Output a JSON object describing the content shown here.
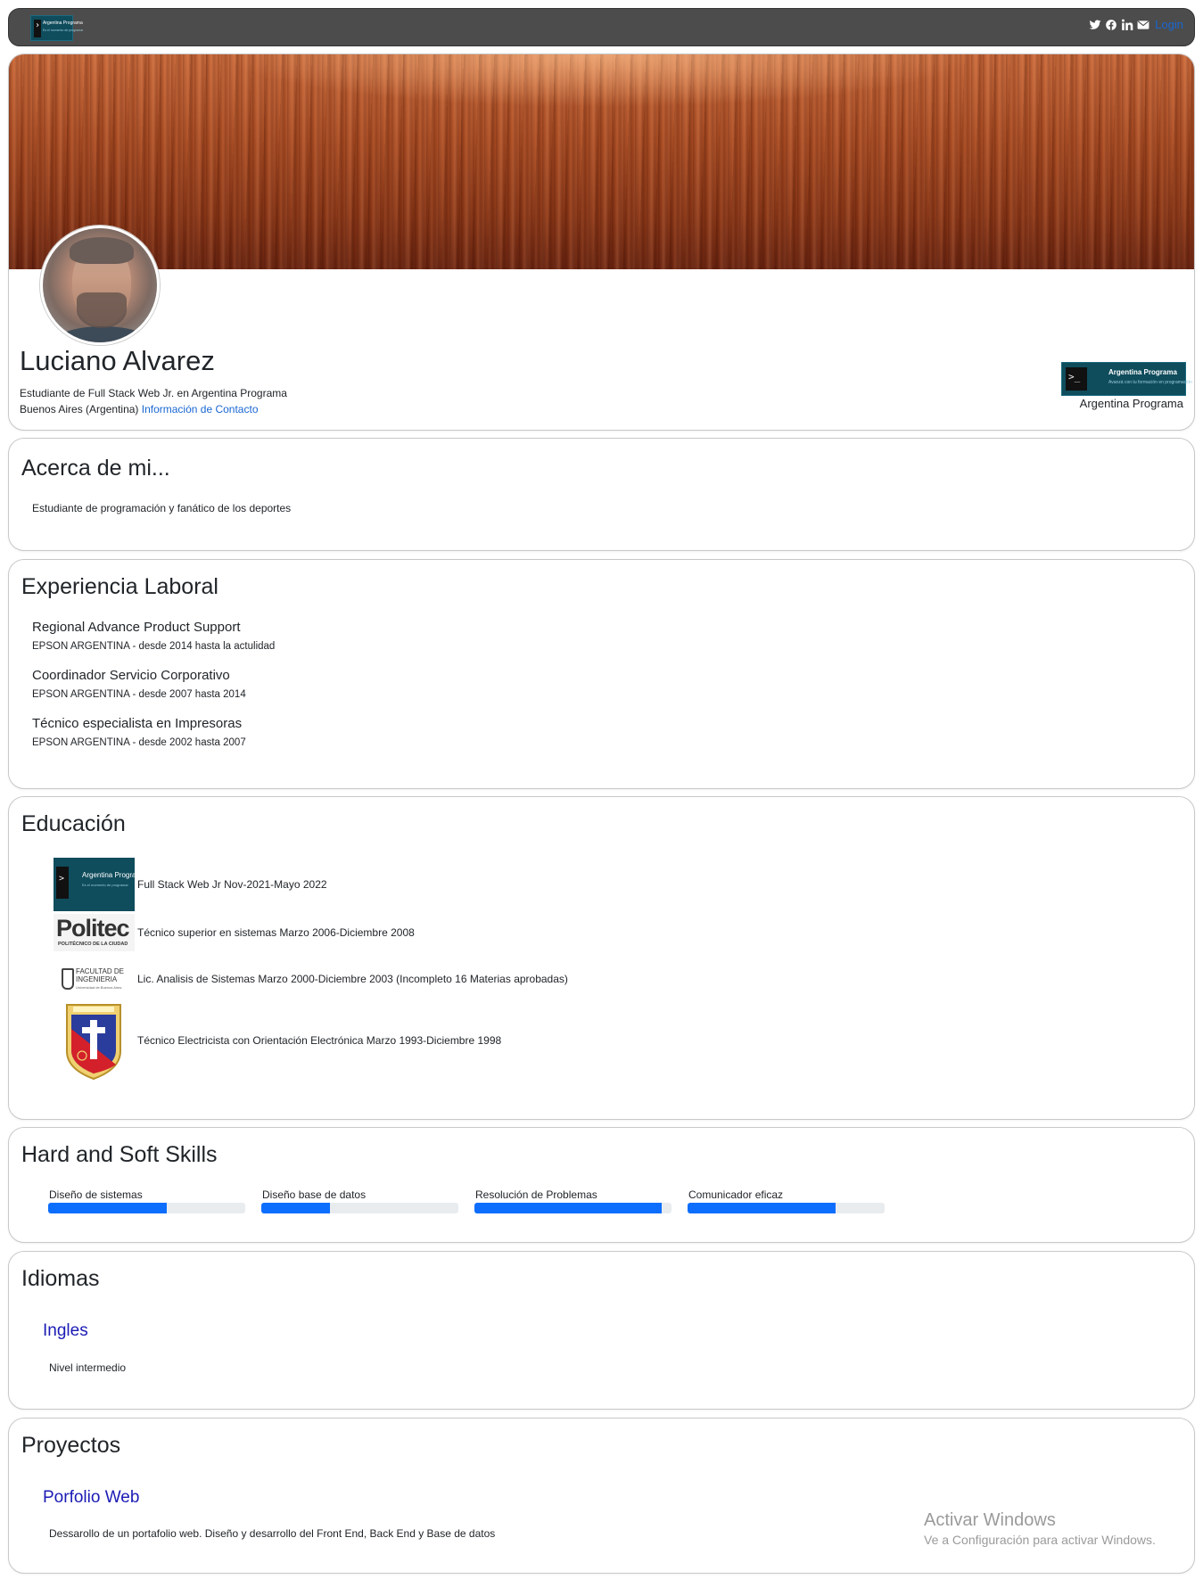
{
  "navbar": {
    "logo_text": "Argentina Programa",
    "logo_subtext": "Es el momento de programar",
    "icons": [
      "twitter-icon",
      "facebook-icon",
      "linkedin-icon",
      "envelope-icon"
    ],
    "login_label": "Login"
  },
  "profile": {
    "name": "Luciano Alvarez",
    "title": "Estudiante de Full Stack Web Jr. en Argentina Programa",
    "location": "Buenos Aires (Argentina)",
    "contact_link": "Información de Contacto",
    "org_logo_text": "Argentina Programa",
    "org_logo_subtext": "Avanzá con tu formación en programación",
    "org_caption": "Argentina Programa"
  },
  "about": {
    "heading": "Acerca de mi...",
    "text": "Estudiante de programación y fanático de los deportes"
  },
  "experience": {
    "heading": "Experiencia Laboral",
    "items": [
      {
        "title": "Regional Advance Product Support",
        "sub": "EPSON ARGENTINA - desde 2014 hasta la actulidad"
      },
      {
        "title": "Coordinador Servicio Corporativo",
        "sub": "EPSON ARGENTINA - desde 2007 hasta 2014"
      },
      {
        "title": "Técnico especialista en Impresoras",
        "sub": "EPSON ARGENTINA - desde 2002 hasta 2007"
      }
    ]
  },
  "education": {
    "heading": "Educación",
    "items": [
      {
        "logo": "argentina-programa-logo",
        "logo_text": "Argentina Programa",
        "logo_subtext": "Es el momento de programar",
        "text": "Full Stack Web Jr Nov-2021-Mayo 2022"
      },
      {
        "logo": "politec-logo",
        "logo_text": "Politec",
        "logo_subtext": "POLITÉCNICO DE LA CIUDAD",
        "text": "Técnico superior en sistemas Marzo 2006-Diciembre 2008"
      },
      {
        "logo": "facultad-ingenieria-logo",
        "logo_text": "FACULTAD DE INGENIERIA",
        "logo_subtext": "Universidad de Buenos Aires",
        "text": "Lic. Analisis de Sistemas Marzo 2000-Diciembre 2003 (Incompleto 16 Materias aprobadas)"
      },
      {
        "logo": "school-crest-logo",
        "text": "Técnico Electricista con Orientación Electrónica Marzo 1993-Diciembre 1998"
      }
    ]
  },
  "skills": {
    "heading": "Hard and Soft Skills",
    "items": [
      {
        "label": "Diseño de sistemas",
        "level": 0.6
      },
      {
        "label": "Diseño base de datos",
        "level": 0.35
      },
      {
        "label": "Resolución de Problemas",
        "level": 0.95
      },
      {
        "label": "Comunicador eficaz",
        "level": 0.75
      }
    ],
    "bar_color": "#0d6efd"
  },
  "languages": {
    "heading": "Idiomas",
    "items": [
      {
        "name": "Ingles",
        "level": "Nivel intermedio"
      }
    ]
  },
  "projects": {
    "heading": "Proyectos",
    "items": [
      {
        "name": "Porfolio Web",
        "description": "Dessarollo de un portafolio web. Diseño y desarrollo del Front End, Back End y Base de datos"
      }
    ]
  },
  "windows_watermark": {
    "title": "Activar Windows",
    "subtitle": "Ve a Configuración para activar Windows."
  },
  "colors": {
    "navbar_bg": "#4c4c4c",
    "link": "#1967d2",
    "accent_title": "#1b1bb5",
    "progress": "#0d6efd"
  }
}
